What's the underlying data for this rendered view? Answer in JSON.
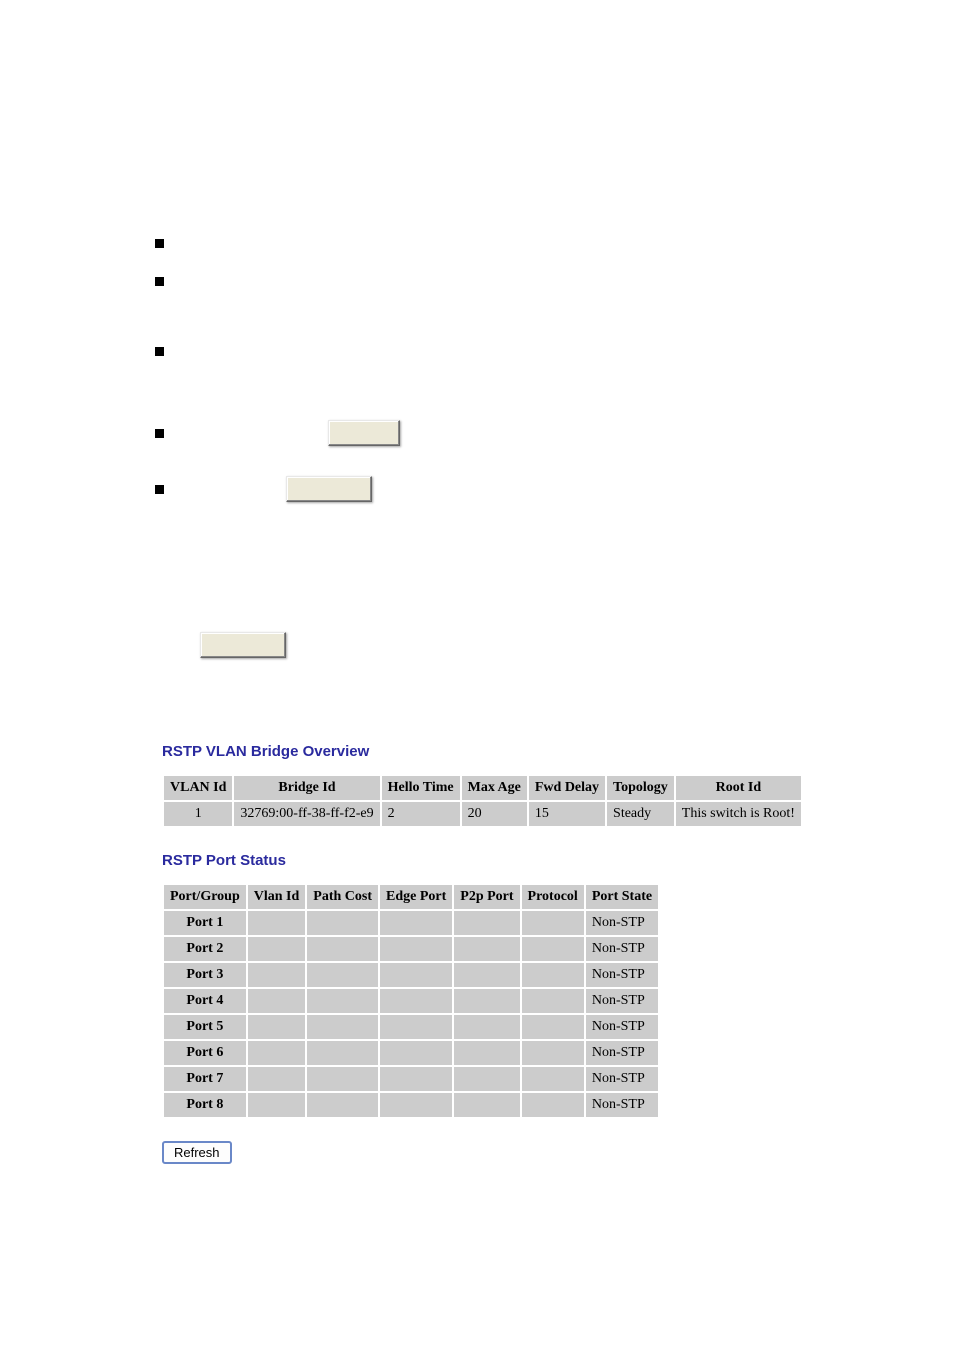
{
  "headings": {
    "bridge_overview": "RSTP VLAN Bridge Overview",
    "port_status": "RSTP Port Status"
  },
  "bridge_table": {
    "headers": [
      "VLAN Id",
      "Bridge Id",
      "Hello Time",
      "Max Age",
      "Fwd Delay",
      "Topology",
      "Root Id"
    ],
    "rows": [
      {
        "vlan_id": "1",
        "bridge_id": "32769:00-ff-38-ff-f2-e9",
        "hello_time": "2",
        "max_age": "20",
        "fwd_delay": "15",
        "topology": "Steady",
        "root_id": "This switch is Root!"
      }
    ]
  },
  "port_table": {
    "headers": [
      "Port/Group",
      "Vlan Id",
      "Path Cost",
      "Edge Port",
      "P2p Port",
      "Protocol",
      "Port State"
    ],
    "rows": [
      {
        "port": "Port 1",
        "vlan_id": "",
        "path_cost": "",
        "edge_port": "",
        "p2p_port": "",
        "protocol": "",
        "port_state": "Non-STP"
      },
      {
        "port": "Port 2",
        "vlan_id": "",
        "path_cost": "",
        "edge_port": "",
        "p2p_port": "",
        "protocol": "",
        "port_state": "Non-STP"
      },
      {
        "port": "Port 3",
        "vlan_id": "",
        "path_cost": "",
        "edge_port": "",
        "p2p_port": "",
        "protocol": "",
        "port_state": "Non-STP"
      },
      {
        "port": "Port 4",
        "vlan_id": "",
        "path_cost": "",
        "edge_port": "",
        "p2p_port": "",
        "protocol": "",
        "port_state": "Non-STP"
      },
      {
        "port": "Port 5",
        "vlan_id": "",
        "path_cost": "",
        "edge_port": "",
        "p2p_port": "",
        "protocol": "",
        "port_state": "Non-STP"
      },
      {
        "port": "Port 6",
        "vlan_id": "",
        "path_cost": "",
        "edge_port": "",
        "p2p_port": "",
        "protocol": "",
        "port_state": "Non-STP"
      },
      {
        "port": "Port 7",
        "vlan_id": "",
        "path_cost": "",
        "edge_port": "",
        "p2p_port": "",
        "protocol": "",
        "port_state": "Non-STP"
      },
      {
        "port": "Port 8",
        "vlan_id": "",
        "path_cost": "",
        "edge_port": "",
        "p2p_port": "",
        "protocol": "",
        "port_state": "Non-STP"
      }
    ]
  },
  "buttons": {
    "refresh": "Refresh"
  }
}
